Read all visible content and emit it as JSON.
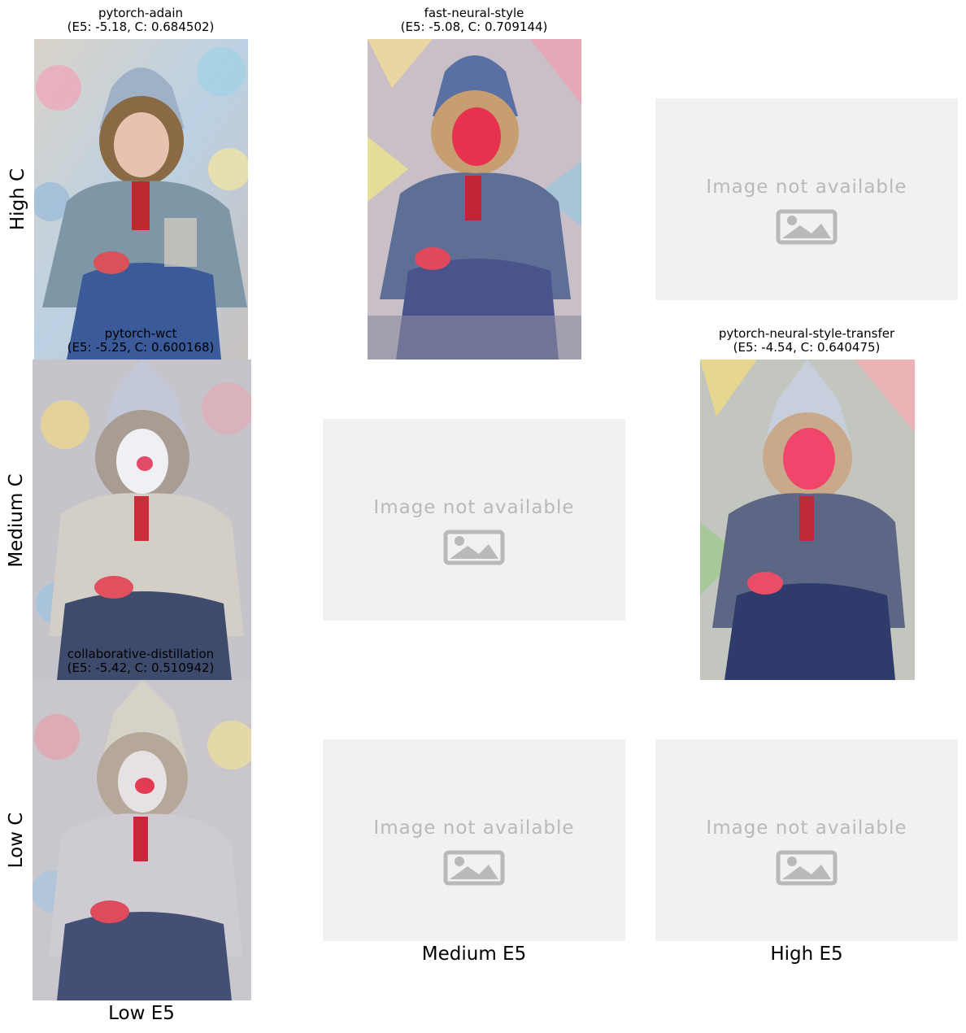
{
  "panels": {
    "high_c_low_e5": {
      "title": "pytorch-adain",
      "subtitle": "(E5: -5.18, C: 0.684502)"
    },
    "high_c_medium_e5": {
      "title": "fast-neural-style",
      "subtitle": "(E5: -5.08, C: 0.709144)"
    },
    "medium_c_low_e5": {
      "title": "pytorch-wct",
      "subtitle": "(E5: -5.25, C: 0.600168)"
    },
    "medium_c_high_e5": {
      "title": "pytorch-neural-style-transfer",
      "subtitle": "(E5: -4.54, C: 0.640475)"
    },
    "low_c_low_e5": {
      "title": "collaborative-distillation",
      "subtitle": "(E5: -5.42, C: 0.510942)"
    }
  },
  "placeholder": {
    "text": "Image not available",
    "icon": "image-icon"
  },
  "axes": {
    "rows": [
      "High C",
      "Medium C",
      "Low C"
    ],
    "cols": [
      "Low E5",
      "Medium E5",
      "High E5"
    ]
  },
  "colors": {
    "placeholder_bg": "#f1f1f1",
    "placeholder_fg": "#b9b9b9"
  }
}
